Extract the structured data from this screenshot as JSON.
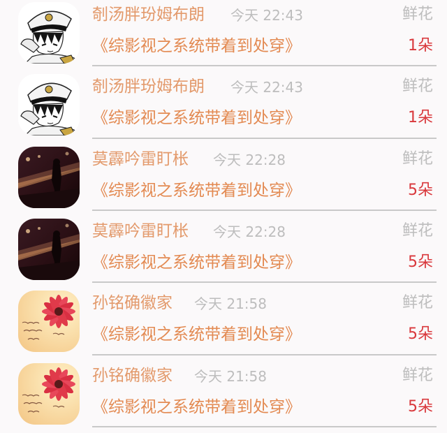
{
  "rows": [
    {
      "name": "剞汤胖玢姆布朗",
      "time": "今天 22:43",
      "gift_label": "鲜花",
      "book": "《综影视之系统带着到处穿》",
      "count": "1朵",
      "avatar_icon": "sailor-boy-avatar-icon"
    },
    {
      "name": "剞汤胖玢姆布朗",
      "time": "今天 22:43",
      "gift_label": "鲜花",
      "book": "《综影视之系统带着到处穿》",
      "count": "1朵",
      "avatar_icon": "sailor-boy-avatar-icon"
    },
    {
      "name": "莫霹吟雷盯枨",
      "time": "今天 22:28",
      "gift_label": "鲜花",
      "book": "《综影视之系统带着到处穿》",
      "count": "5朵",
      "avatar_icon": "night-street-avatar-icon"
    },
    {
      "name": "莫霹吟雷盯枨",
      "time": "今天 22:28",
      "gift_label": "鲜花",
      "book": "《综影视之系统带着到处穿》",
      "count": "5朵",
      "avatar_icon": "night-street-avatar-icon"
    },
    {
      "name": "孙铭确徽家",
      "time": "今天 21:58",
      "gift_label": "鲜花",
      "book": "《综影视之系统带着到处穿》",
      "count": "5朵",
      "avatar_icon": "red-flower-avatar-icon"
    },
    {
      "name": "孙铭确徽家",
      "time": "今天 21:58",
      "gift_label": "鲜花",
      "book": "《综影视之系统带着到处穿》",
      "count": "5朵",
      "avatar_icon": "red-flower-avatar-icon"
    }
  ],
  "colors": {
    "name": "#e39a6c",
    "book": "#e38a52",
    "count": "#d9383c",
    "muted": "#bdbdbd",
    "divider": "#c9c9c9",
    "background": "#fbf9fa"
  }
}
